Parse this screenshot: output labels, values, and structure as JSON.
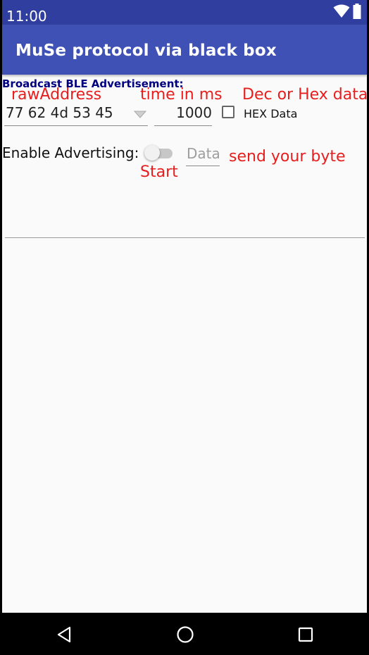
{
  "status_bar": {
    "time": "11:00"
  },
  "app_bar": {
    "title": "MuSe protocol via black box"
  },
  "form": {
    "section_title": "Broadcast BLE Advertisement:",
    "raw_address_value": "77 62 4d 53 45",
    "interval_value": "1000",
    "hex_checkbox_label": "HEX Data",
    "hex_checked": false,
    "advertising_label": "Enable Advertising:",
    "advertising_enabled": false,
    "data_placeholder": "Data"
  },
  "annotations": {
    "raw_address": "rawAddress",
    "time": "time in ms",
    "dec_hex": "Dec or Hex data",
    "start": "Start",
    "send_byte": "send your byte",
    "color": "#e81e1e"
  },
  "colors": {
    "app_bar": "#3f51b5",
    "status_bar": "#303f9f",
    "section_title": "#000080"
  }
}
